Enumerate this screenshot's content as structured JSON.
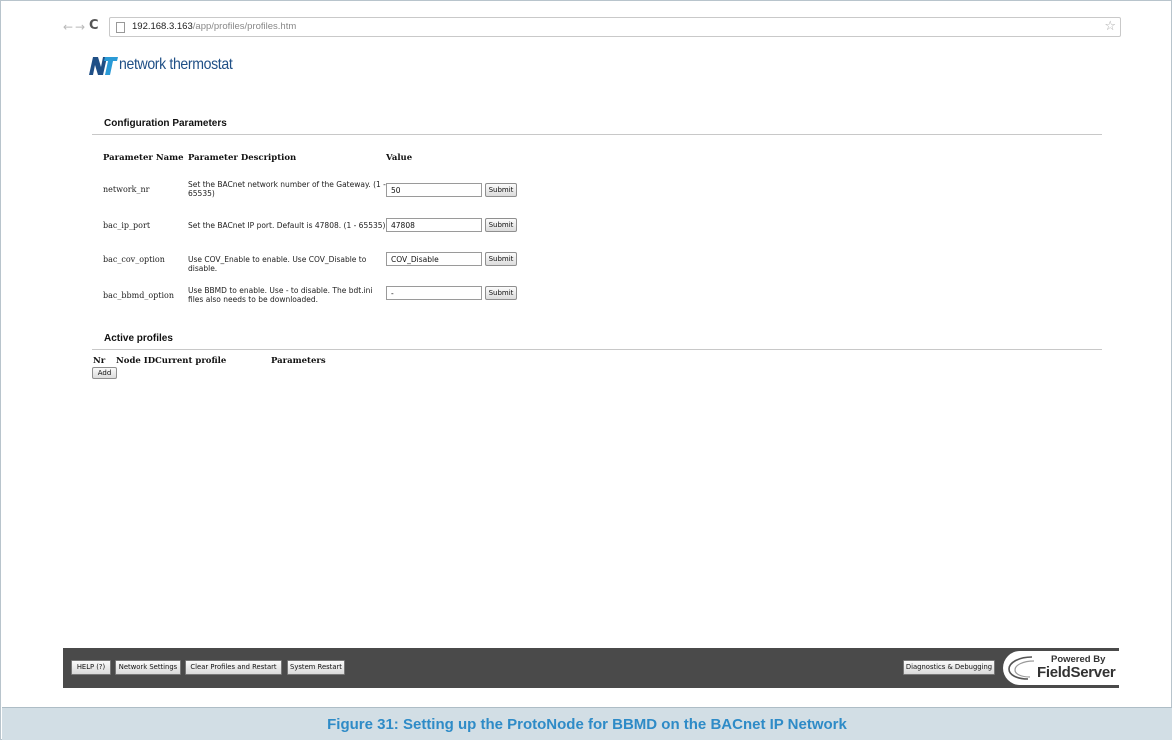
{
  "browser": {
    "url_host": "192.168.3.163",
    "url_path": "/app/profiles/profiles.htm"
  },
  "logo": {
    "mark": "NT",
    "text": "network thermostat"
  },
  "config": {
    "title": "Configuration Parameters",
    "headers": {
      "name": "Parameter Name",
      "description": "Parameter Description",
      "value": "Value"
    },
    "rows": [
      {
        "name": "network_nr",
        "description": "Set the BACnet network number of the Gateway. (1 - 65535)",
        "value": "50",
        "button": "Submit"
      },
      {
        "name": "bac_ip_port",
        "description": "Set the BACnet IP port. Default is 47808. (1 - 65535)",
        "value": "47808",
        "button": "Submit"
      },
      {
        "name": "bac_cov_option",
        "description": "Use COV_Enable to enable. Use COV_Disable to disable.",
        "value": "COV_Disable",
        "button": "Submit"
      },
      {
        "name": "bac_bbmd_option",
        "description": "Use BBMD to enable. Use - to disable. The bdt.ini files also needs to be downloaded.",
        "value": "-",
        "button": "Submit"
      }
    ]
  },
  "profiles": {
    "title": "Active profiles",
    "headers": {
      "nr": "Nr",
      "node_id": "Node ID",
      "current_profile": "Current profile",
      "parameters": "Parameters"
    },
    "add_label": "Add"
  },
  "footer": {
    "help": "HELP (?)",
    "network_settings": "Network Settings",
    "clear_profiles": "Clear Profiles and Restart",
    "system_restart": "System Restart",
    "diagnostics": "Diagnostics & Debugging",
    "powered_by": "Powered By",
    "brand": "FieldServer"
  },
  "caption": "Figure 31: Setting up the ProtoNode for BBMD on the BACnet IP Network",
  "colors": {
    "logo_blue": "#1f4f86",
    "caption_blue": "#2e8bc7",
    "caption_band": "#d2dee5",
    "footer_bg": "#4a4a4a"
  }
}
